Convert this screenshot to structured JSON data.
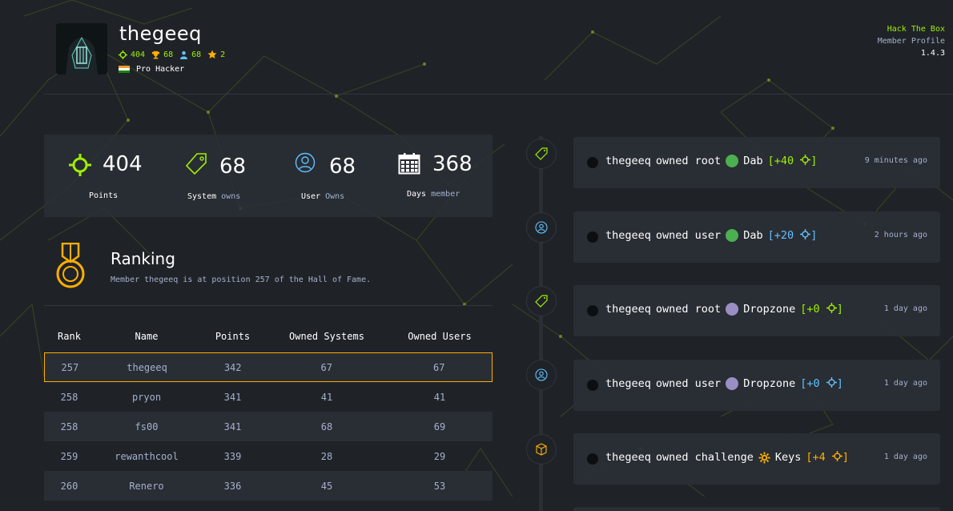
{
  "profile": {
    "username": "thegeeq",
    "points": "404",
    "trophies": "68",
    "users": "68",
    "stars": "2",
    "rank_name": "Pro Hacker"
  },
  "brand": {
    "line1": "Hack The Box",
    "line2": "Member Profile",
    "version": "1.4.3"
  },
  "stats": [
    {
      "value": "404",
      "label": "Points",
      "sub": "",
      "icon": "crosshair-icon",
      "color": "#9fef00"
    },
    {
      "value": "68",
      "label": "System",
      "sub": "owns",
      "icon": "tag-icon",
      "color": "#9fef00"
    },
    {
      "value": "68",
      "label": "User",
      "sub": "Owns",
      "icon": "user-circle-icon",
      "color": "#62c0ff"
    },
    {
      "value": "368",
      "label": "Days",
      "sub": "member",
      "icon": "calendar-icon",
      "color": "#ffffff"
    }
  ],
  "ranking": {
    "title": "Ranking",
    "subtitle": "Member thegeeq is at position 257 of the Hall of Fame.",
    "headers": [
      "Rank",
      "Name",
      "Points",
      "Owned Systems",
      "Owned Users"
    ],
    "rows": [
      [
        "257",
        "thegeeq",
        "342",
        "67",
        "67"
      ],
      [
        "258",
        "pryon",
        "341",
        "41",
        "41"
      ],
      [
        "258",
        "fs00",
        "341",
        "68",
        "69"
      ],
      [
        "259",
        "rewanthcool",
        "339",
        "28",
        "29"
      ],
      [
        "260",
        "Renero",
        "336",
        "45",
        "53"
      ]
    ]
  },
  "activity": [
    {
      "user": "thegeeq",
      "verb": "owned root",
      "target": "Dab",
      "points": "[+40",
      "time": "9 minutes ago",
      "kind": "root",
      "color": "#9fef00"
    },
    {
      "user": "thegeeq",
      "verb": "owned user",
      "target": "Dab",
      "points": "[+20",
      "time": "2 hours ago",
      "kind": "user",
      "color": "#62c0ff"
    },
    {
      "user": "thegeeq",
      "verb": "owned root",
      "target": "Dropzone",
      "points": "[+0",
      "time": "1 day ago",
      "kind": "root",
      "color": "#9fef00"
    },
    {
      "user": "thegeeq",
      "verb": "owned user",
      "target": "Dropzone",
      "points": "[+0",
      "time": "1 day ago",
      "kind": "user",
      "color": "#62c0ff"
    },
    {
      "user": "thegeeq",
      "verb": "owned challenge",
      "target": "Keys",
      "points": "[+4",
      "time": "1 day ago",
      "kind": "challenge",
      "color": "#ffaf00"
    }
  ],
  "closing_bracket": "]"
}
